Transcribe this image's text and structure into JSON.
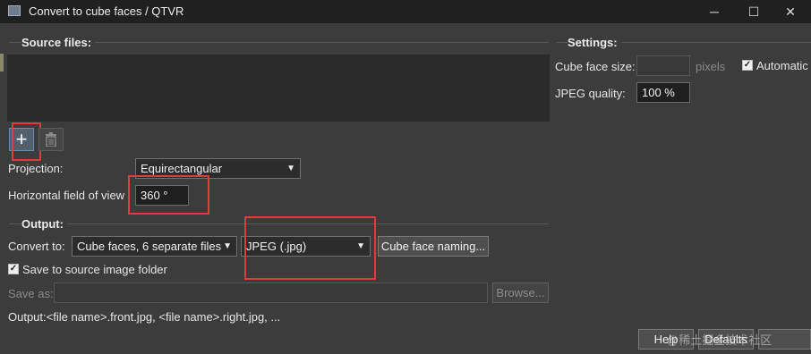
{
  "window": {
    "title": "Convert to cube faces / QTVR",
    "minimize_glyph": "─",
    "maximize_glyph": "☐",
    "close_glyph": "✕"
  },
  "source": {
    "section_label": "Source files:",
    "add_icon": "+",
    "remove_icon": "trash-icon",
    "projection_label": "Projection:",
    "projection_value": "Equirectangular",
    "hfov_label": "Horizontal field of view",
    "hfov_value": "360 °"
  },
  "settings": {
    "section_label": "Settings:",
    "cube_face_size_label": "Cube face size:",
    "cube_face_size_value": "",
    "cube_face_size_unit": "pixels",
    "automatic_label": "Automatic",
    "automatic_checked": true,
    "jpeg_quality_label": "JPEG quality:",
    "jpeg_quality_value": "100 %"
  },
  "output": {
    "section_label": "Output:",
    "convert_to_label": "Convert to:",
    "convert_to_value": "Cube faces, 6 separate files",
    "format_value": "JPEG (.jpg)",
    "cube_face_naming_label": "Cube face naming...",
    "save_to_source_label": "Save to source image folder",
    "save_to_source_checked": true,
    "save_as_label": "Save as:",
    "save_as_value": "",
    "browse_label": "Browse...",
    "output_summary": "Output:<file name>.front.jpg, <file name>.right.jpg, ..."
  },
  "footer": {
    "help_label": "Help",
    "defaults_label": "Defaults",
    "watermark": "@稀土掘金技术社区"
  },
  "colors": {
    "background": "#3c3c3c",
    "titlebar": "#202020",
    "highlight": "#e03c3c"
  }
}
